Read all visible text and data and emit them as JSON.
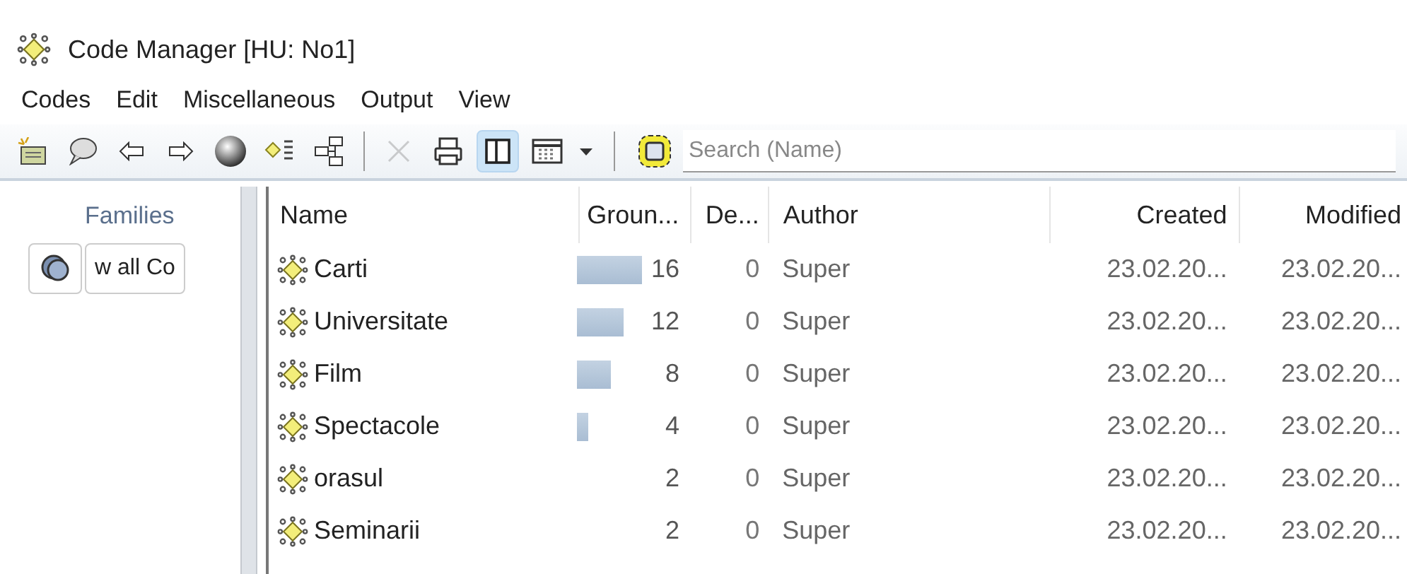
{
  "window": {
    "title": "Code Manager [HU: No1]"
  },
  "menu": [
    "Codes",
    "Edit",
    "Miscellaneous",
    "Output",
    "View"
  ],
  "toolbar": {
    "delete_disabled": true,
    "split_view_selected": true,
    "search": {
      "placeholder": "Search (Name)"
    }
  },
  "families": {
    "title": "Families",
    "show_all_label": "w all Co"
  },
  "table": {
    "columns": [
      "Name",
      "Groun...",
      "De...",
      "Author",
      "Created",
      "Modified"
    ],
    "rows": [
      {
        "name": "Carti",
        "grounded": "16",
        "density": "0",
        "author": "Super",
        "created": "23.02.20...",
        "modified": "23.02.20..."
      },
      {
        "name": "Universitate",
        "grounded": "12",
        "density": "0",
        "author": "Super",
        "created": "23.02.20...",
        "modified": "23.02.20..."
      },
      {
        "name": "Film",
        "grounded": "8",
        "density": "0",
        "author": "Super",
        "created": "23.02.20...",
        "modified": "23.02.20..."
      },
      {
        "name": "Spectacole",
        "grounded": "4",
        "density": "0",
        "author": "Super",
        "created": "23.02.20...",
        "modified": "23.02.20..."
      },
      {
        "name": "orasul",
        "grounded": "2",
        "density": "0",
        "author": "Super",
        "created": "23.02.20...",
        "modified": "23.02.20..."
      },
      {
        "name": "Seminarii",
        "grounded": "2",
        "density": "0",
        "author": "Super",
        "created": "23.02.20...",
        "modified": "23.02.20..."
      }
    ]
  }
}
